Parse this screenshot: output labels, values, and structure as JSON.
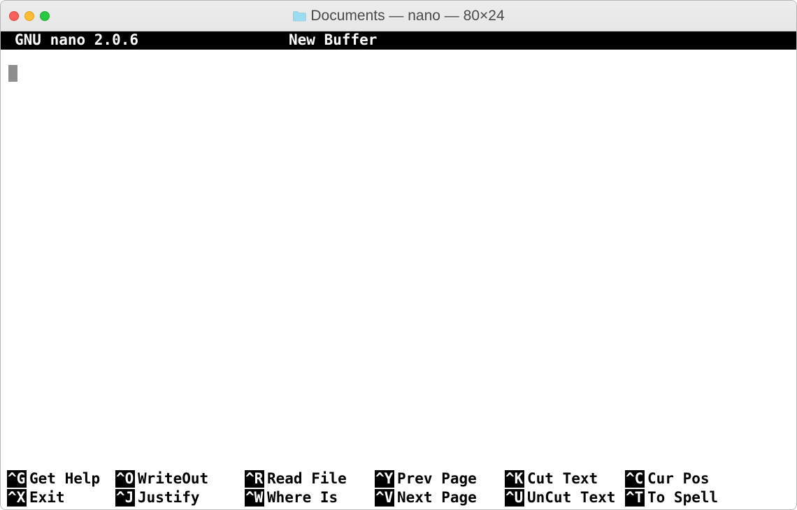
{
  "window": {
    "title": "Documents — nano — 80×24"
  },
  "nano": {
    "app_title": "GNU nano 2.0.6",
    "buffer_title": "New Buffer"
  },
  "shortcuts_row1": [
    {
      "key": "^G",
      "label": "Get Help"
    },
    {
      "key": "^O",
      "label": "WriteOut"
    },
    {
      "key": "^R",
      "label": "Read File"
    },
    {
      "key": "^Y",
      "label": "Prev Page"
    },
    {
      "key": "^K",
      "label": "Cut Text"
    },
    {
      "key": "^C",
      "label": "Cur Pos"
    }
  ],
  "shortcuts_row2": [
    {
      "key": "^X",
      "label": "Exit"
    },
    {
      "key": "^J",
      "label": "Justify"
    },
    {
      "key": "^W",
      "label": "Where Is"
    },
    {
      "key": "^V",
      "label": "Next Page"
    },
    {
      "key": "^U",
      "label": "UnCut Text"
    },
    {
      "key": "^T",
      "label": "To Spell"
    }
  ]
}
